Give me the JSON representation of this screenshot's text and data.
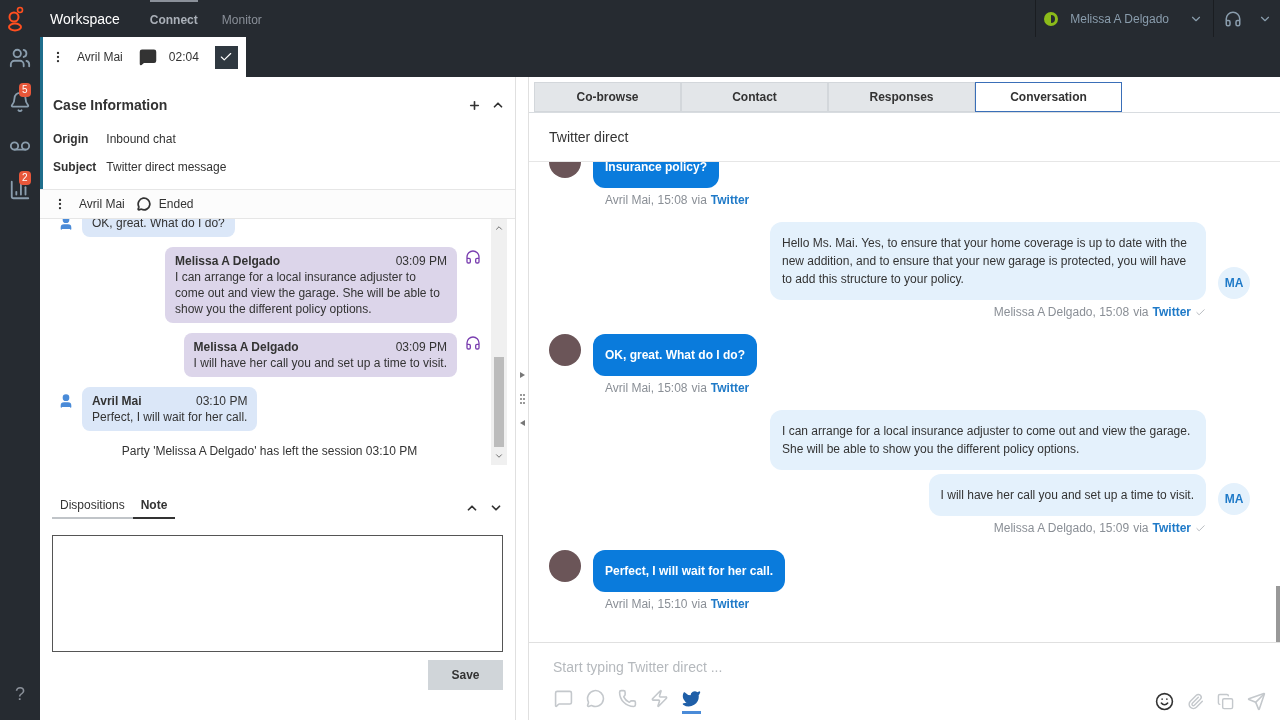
{
  "topbar": {
    "app_title": "Workspace",
    "tabs": [
      {
        "label": "Connect",
        "selected": true
      },
      {
        "label": "Monitor",
        "selected": false
      }
    ],
    "user_name": "Melissa A Delgado"
  },
  "rail": {
    "items": [
      {
        "kind": "team"
      },
      {
        "kind": "bell",
        "badge": "5"
      },
      {
        "kind": "voicemail"
      },
      {
        "kind": "reports",
        "badge": "2"
      }
    ],
    "help": "?"
  },
  "interaction": {
    "name": "Avril Mai",
    "timer": "02:04"
  },
  "case_info": {
    "title": "Case Information",
    "fields": [
      {
        "label": "Origin",
        "value": "Inbound chat"
      },
      {
        "label": "Subject",
        "value": "Twitter direct message"
      }
    ]
  },
  "chat_header": {
    "name": "Avril Mai",
    "status": "Ended"
  },
  "transcript": {
    "messages": [
      {
        "kind": "customer",
        "text": "OK, great. What do I do?"
      },
      {
        "kind": "agent",
        "sender": "Melissa A Delgado",
        "time": "03:09 PM",
        "text": "I can arrange for a local insurance adjuster to come out and view the garage. She will be able to show you the different policy options."
      },
      {
        "kind": "agent",
        "sender": "Melissa A Delgado",
        "time": "03:09 PM",
        "text": "I will have her call you and set up a time to visit."
      },
      {
        "kind": "customer",
        "sender": "Avril Mai",
        "time": "03:10 PM",
        "text": "Perfect, I will wait for her call."
      }
    ],
    "system_line": "Party 'Melissa A Delgado' has left the session 03:10 PM"
  },
  "note_panel": {
    "tabs": [
      {
        "label": "Dispositions",
        "selected": false
      },
      {
        "label": "Note",
        "selected": true
      }
    ],
    "save": "Save"
  },
  "right_tabs": [
    {
      "label": "Co-browse",
      "selected": false
    },
    {
      "label": "Contact",
      "selected": false
    },
    {
      "label": "Responses",
      "selected": false
    },
    {
      "label": "Conversation",
      "selected": true
    }
  ],
  "conversation": {
    "title": "Twitter direct",
    "groups": [
      {
        "kind": "inbound",
        "bubbles": [
          "Insurance policy?"
        ],
        "meta": "Avril Mai, 15:08",
        "via": "via",
        "channel": "Twitter"
      },
      {
        "kind": "outbound",
        "bubbles": [
          "Hello Ms. Mai. Yes, to ensure that your home coverage is up to date with the new addition, and to ensure that your new garage is protected, you will have to add this structure to your policy."
        ],
        "meta": "Melissa A Delgado, 15:08",
        "via": "via",
        "channel": "Twitter",
        "delivered": true,
        "initials": "MA"
      },
      {
        "kind": "inbound",
        "bubbles": [
          "OK, great. What do I do?"
        ],
        "meta": "Avril Mai, 15:08",
        "via": "via",
        "channel": "Twitter"
      },
      {
        "kind": "outbound",
        "bubbles": [
          "I can arrange for a local insurance adjuster to come out and view the garage. She will be able to show you the different policy options.",
          "I will have her call you and set up a time to visit."
        ],
        "meta": "Melissa A Delgado, 15:09",
        "via": "via",
        "channel": "Twitter",
        "delivered": true,
        "initials": "MA"
      },
      {
        "kind": "inbound",
        "bubbles": [
          "Perfect, I will wait for her call."
        ],
        "meta": "Avril Mai, 15:10",
        "via": "via",
        "channel": "Twitter"
      }
    ],
    "composer_placeholder": "Start typing Twitter direct ...",
    "channels": [
      {
        "kind": "chat",
        "selected": false
      },
      {
        "kind": "sms",
        "selected": false
      },
      {
        "kind": "whatsapp",
        "selected": false
      },
      {
        "kind": "messenger",
        "selected": false
      },
      {
        "kind": "twitter",
        "selected": true
      }
    ]
  }
}
